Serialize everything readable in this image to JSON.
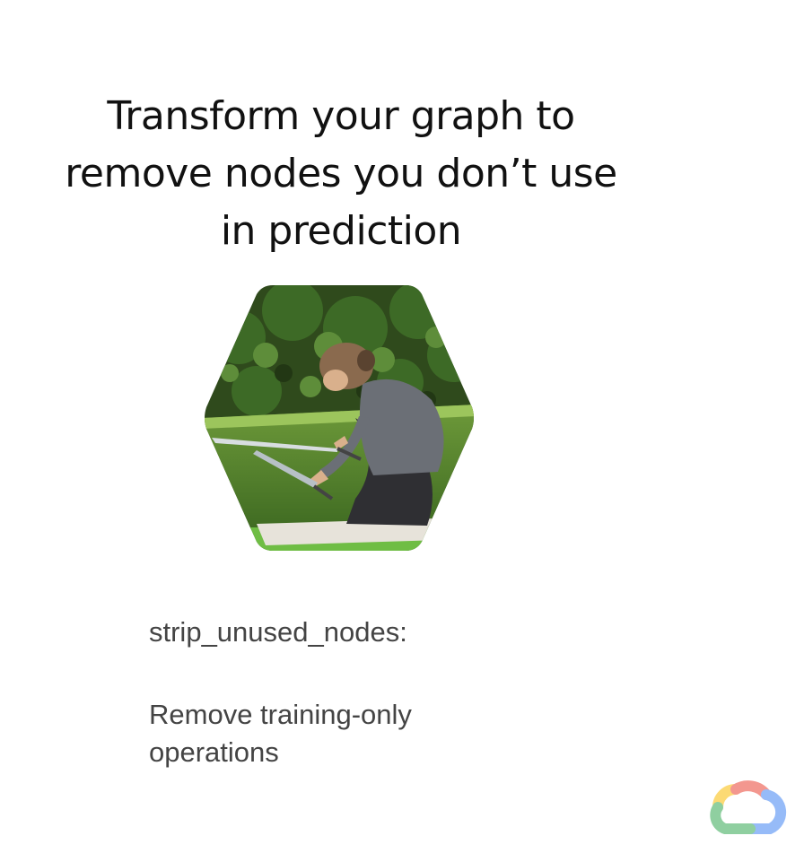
{
  "slide": {
    "title_lines": [
      "Transform your graph to",
      "remove nodes you don’t use",
      "in prediction"
    ],
    "caption_title": "strip_unused_nodes:",
    "caption_body_lines": [
      "Remove training-only",
      "operations"
    ]
  },
  "image": {
    "subject": "gardener trimming a hedge with shears",
    "shape": "hexagon"
  },
  "logo": {
    "icon": "google-cloud-icon",
    "colors": [
      "#EA4335",
      "#FBBC04",
      "#34A853",
      "#4285F4"
    ]
  }
}
